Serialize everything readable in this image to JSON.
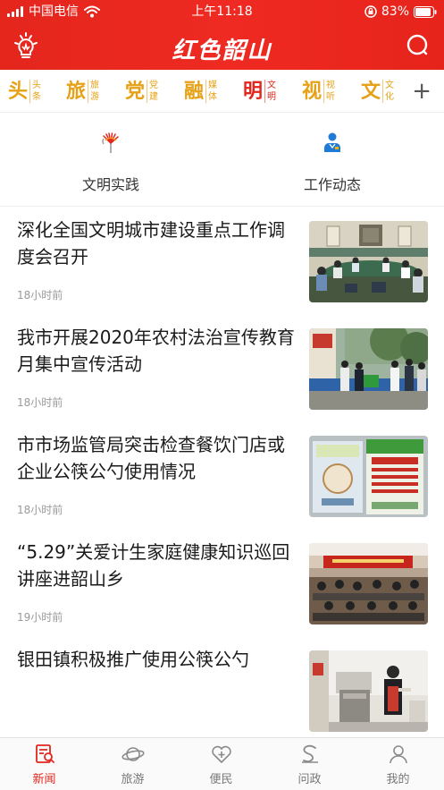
{
  "status_bar": {
    "carrier": "中国电信",
    "time": "上午11:18",
    "battery": "83%"
  },
  "header": {
    "logo_text": "红色韶山",
    "icons": [
      "bulb-icon",
      "search-icon"
    ],
    "background_color": "#e8261d"
  },
  "channels": [
    {
      "big": "头",
      "small": "头条"
    },
    {
      "big": "旅",
      "small": "旅游"
    },
    {
      "big": "党",
      "small": "党建"
    },
    {
      "big": "融",
      "small": "媒体"
    },
    {
      "big": "明",
      "small": "文明"
    },
    {
      "big": "视",
      "small": "视听"
    },
    {
      "big": "文",
      "small": "文化"
    }
  ],
  "channel_active_index": 4,
  "channel_add_label": "+",
  "sub_sections": [
    {
      "label": "文明实践",
      "icon": "torch-icon"
    },
    {
      "label": "工作动态",
      "icon": "person-icon"
    }
  ],
  "news": [
    {
      "title": "深化全国文明城市建设重点工作调度会召开",
      "time": "18小时前",
      "thumb": "meeting-room-photo"
    },
    {
      "title": "我市开展2020年农村法治宣传教育月集中宣传活动",
      "time": "18小时前",
      "thumb": "outdoor-event-photo"
    },
    {
      "title": "市市场监管局突击检查餐饮门店或企业公筷公勺使用情况",
      "time": "18小时前",
      "thumb": "poster-photo"
    },
    {
      "title": "“5.29”关爱计生家庭健康知识巡回讲座进韶山乡",
      "time": "19小时前",
      "thumb": "lecture-hall-photo"
    },
    {
      "title": "银田镇积极推广使用公筷公勺",
      "time": "",
      "thumb": "kitchen-photo"
    }
  ],
  "bottom_nav": [
    {
      "label": "新闻",
      "icon": "news-icon"
    },
    {
      "label": "旅游",
      "icon": "planet-icon"
    },
    {
      "label": "便民",
      "icon": "heart-plus-icon"
    },
    {
      "label": "问政",
      "icon": "question-s-icon"
    },
    {
      "label": "我的",
      "icon": "user-icon"
    }
  ],
  "bottom_nav_active_index": 0,
  "colors": {
    "accent": "#e3251c",
    "channel": "#e6a116",
    "muted": "#999999"
  }
}
